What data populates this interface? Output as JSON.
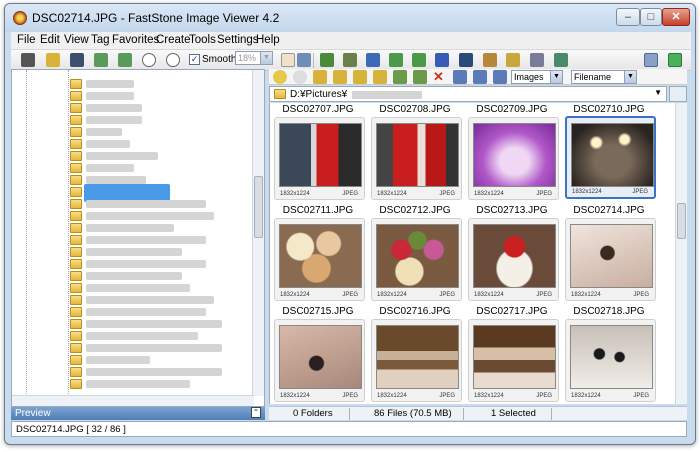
{
  "window": {
    "title": "DSC02714.JPG  -  FastStone Image Viewer 4.2",
    "buttons": {
      "minimize": "–",
      "maximize": "□",
      "close": "✕"
    }
  },
  "menu": [
    "File",
    "Edit",
    "View",
    "Tag",
    "Favorites",
    "Create",
    "Tools",
    "Settings",
    "Help"
  ],
  "toolbar": {
    "smooth_label": "Smooth",
    "smooth_checked": true,
    "zoom_value": "18%"
  },
  "browser": {
    "filter": "Images",
    "sort": "Filename",
    "path": "D:¥Pictures¥"
  },
  "preview_label": "Preview",
  "files": {
    "row_above": [
      "DSC02707.JPG",
      "DSC02708.JPG",
      "DSC02709.JPG",
      "DSC02710.JPG"
    ],
    "items": [
      {
        "name": "DSC02711.JPG",
        "dims": "1832x1224",
        "fmt": "JPEG"
      },
      {
        "name": "DSC02712.JPG",
        "dims": "1832x1224",
        "fmt": "JPEG"
      },
      {
        "name": "DSC02713.JPG",
        "dims": "1832x1224",
        "fmt": "JPEG"
      },
      {
        "name": "DSC02714.JPG",
        "dims": "1832x1224",
        "fmt": "JPEG"
      },
      {
        "name": "DSC02715.JPG",
        "dims": "1832x1224",
        "fmt": "JPEG"
      },
      {
        "name": "DSC02716.JPG",
        "dims": "1832x1224",
        "fmt": "JPEG"
      },
      {
        "name": "DSC02717.JPG",
        "dims": "1832x1224",
        "fmt": "JPEG"
      },
      {
        "name": "DSC02718.JPG",
        "dims": "1832x1224",
        "fmt": "JPEG"
      }
    ],
    "first_row": [
      {
        "dims": "1832x1224",
        "fmt": "JPEG"
      },
      {
        "dims": "1832x1224",
        "fmt": "JPEG"
      },
      {
        "dims": "1832x1224",
        "fmt": "JPEG"
      },
      {
        "dims": "1832x1224",
        "fmt": "JPEG"
      }
    ]
  },
  "status": {
    "folders": "0 Folders",
    "files": "86 Files (70.5 MB)",
    "selected": "1 Selected"
  },
  "bottom": "DSC02714.JPG [ 32 / 86 ]"
}
